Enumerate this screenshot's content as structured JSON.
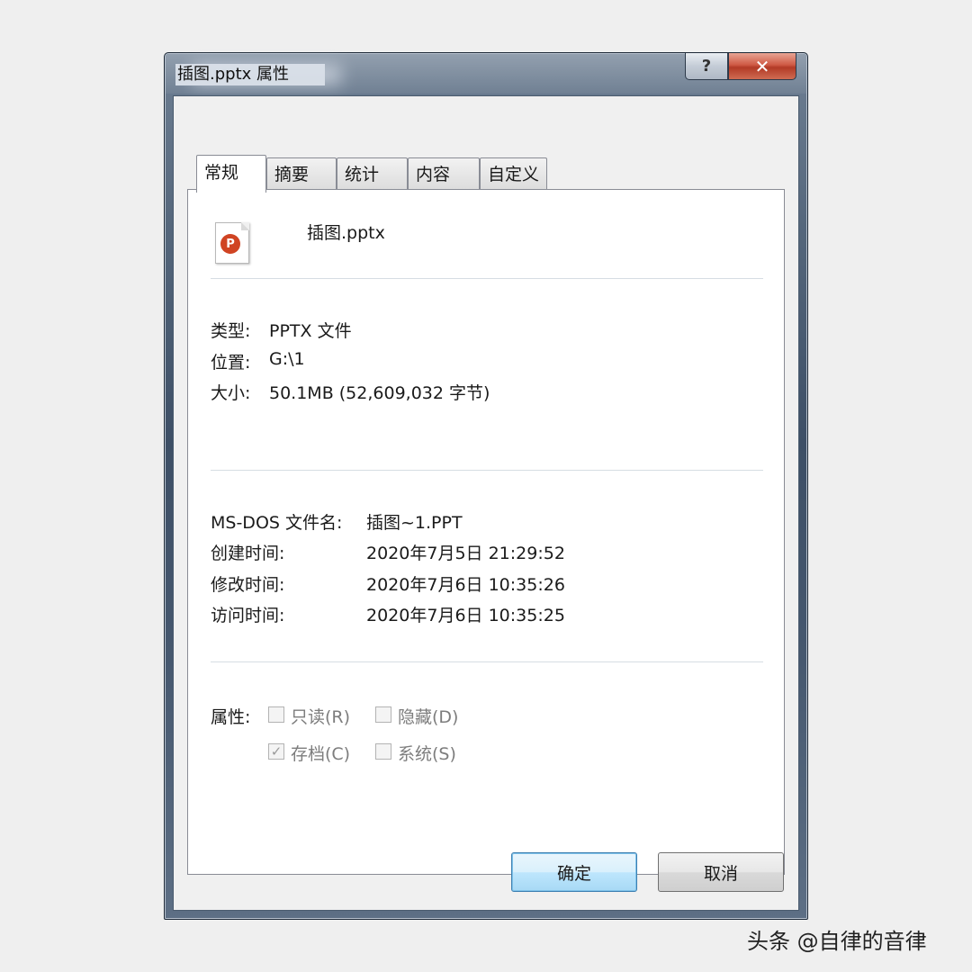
{
  "window": {
    "title": "插图.pptx 属性",
    "help_label": "?",
    "close_label": "✕"
  },
  "tabs": [
    {
      "label": "常规",
      "active": true
    },
    {
      "label": "摘要",
      "active": false
    },
    {
      "label": "统计",
      "active": false
    },
    {
      "label": "内容",
      "active": false
    },
    {
      "label": "自定义",
      "active": false
    }
  ],
  "file": {
    "icon": "powerpoint-file-icon",
    "icon_letter": "P",
    "name": "插图.pptx"
  },
  "info": {
    "type_label": "类型:",
    "type_value": "PPTX 文件",
    "location_label": "位置:",
    "location_value": "G:\\1",
    "size_label": "大小:",
    "size_value": "50.1MB (52,609,032 字节)"
  },
  "details": {
    "msdos_label": "MS-DOS 文件名:",
    "msdos_value": "插图~1.PPT",
    "created_label": "创建时间:",
    "created_value": "2020年7月5日 21:29:52",
    "modified_label": "修改时间:",
    "modified_value": "2020年7月6日 10:35:26",
    "accessed_label": "访问时间:",
    "accessed_value": "2020年7月6日 10:35:25"
  },
  "attributes": {
    "label": "属性:",
    "readonly": {
      "label": "只读(R)",
      "checked": false
    },
    "hidden": {
      "label": "隐藏(D)",
      "checked": false
    },
    "archive": {
      "label": "存档(C)",
      "checked": true
    },
    "system": {
      "label": "系统(S)",
      "checked": false
    },
    "check_mark": "✓"
  },
  "buttons": {
    "ok": "确定",
    "cancel": "取消"
  },
  "watermark": "头条 @自律的音律",
  "colors": {
    "close_button": "#c8462f",
    "default_button_border": "#3c7fb1",
    "window_frame": "#4a5d75"
  }
}
